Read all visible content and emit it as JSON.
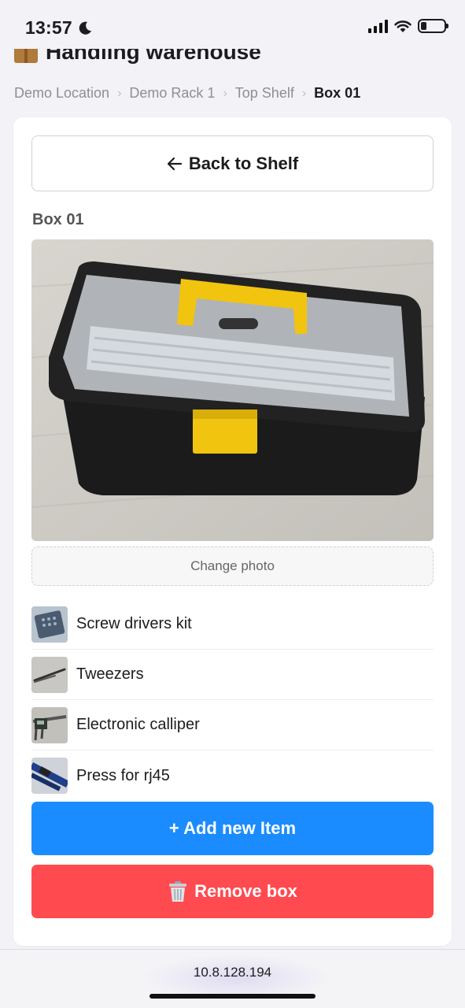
{
  "status_bar": {
    "time": "13:57",
    "battery_level": 0.25
  },
  "header": {
    "title": "Handling warehouse",
    "icon": "package-icon"
  },
  "breadcrumb": [
    "Demo Location",
    "Demo Rack 1",
    "Top Shelf",
    "Box 01"
  ],
  "card": {
    "back_label": "Back to Shelf",
    "box_name": "Box 01",
    "change_photo_label": "Change photo",
    "items": [
      {
        "label": "Screw drivers kit",
        "thumb": "screwdriver-kit-thumb"
      },
      {
        "label": "Tweezers",
        "thumb": "tweezers-thumb"
      },
      {
        "label": "Electronic calliper",
        "thumb": "calliper-thumb"
      },
      {
        "label": "Press for rj45",
        "thumb": "rj45-press-thumb"
      }
    ],
    "add_label": "+ Add new Item",
    "remove_label": "Remove box"
  },
  "browser": {
    "url": "10.8.128.194"
  },
  "colors": {
    "primary": "#1a8cff",
    "danger": "#ff4a4f",
    "background": "#f2f2f7"
  }
}
